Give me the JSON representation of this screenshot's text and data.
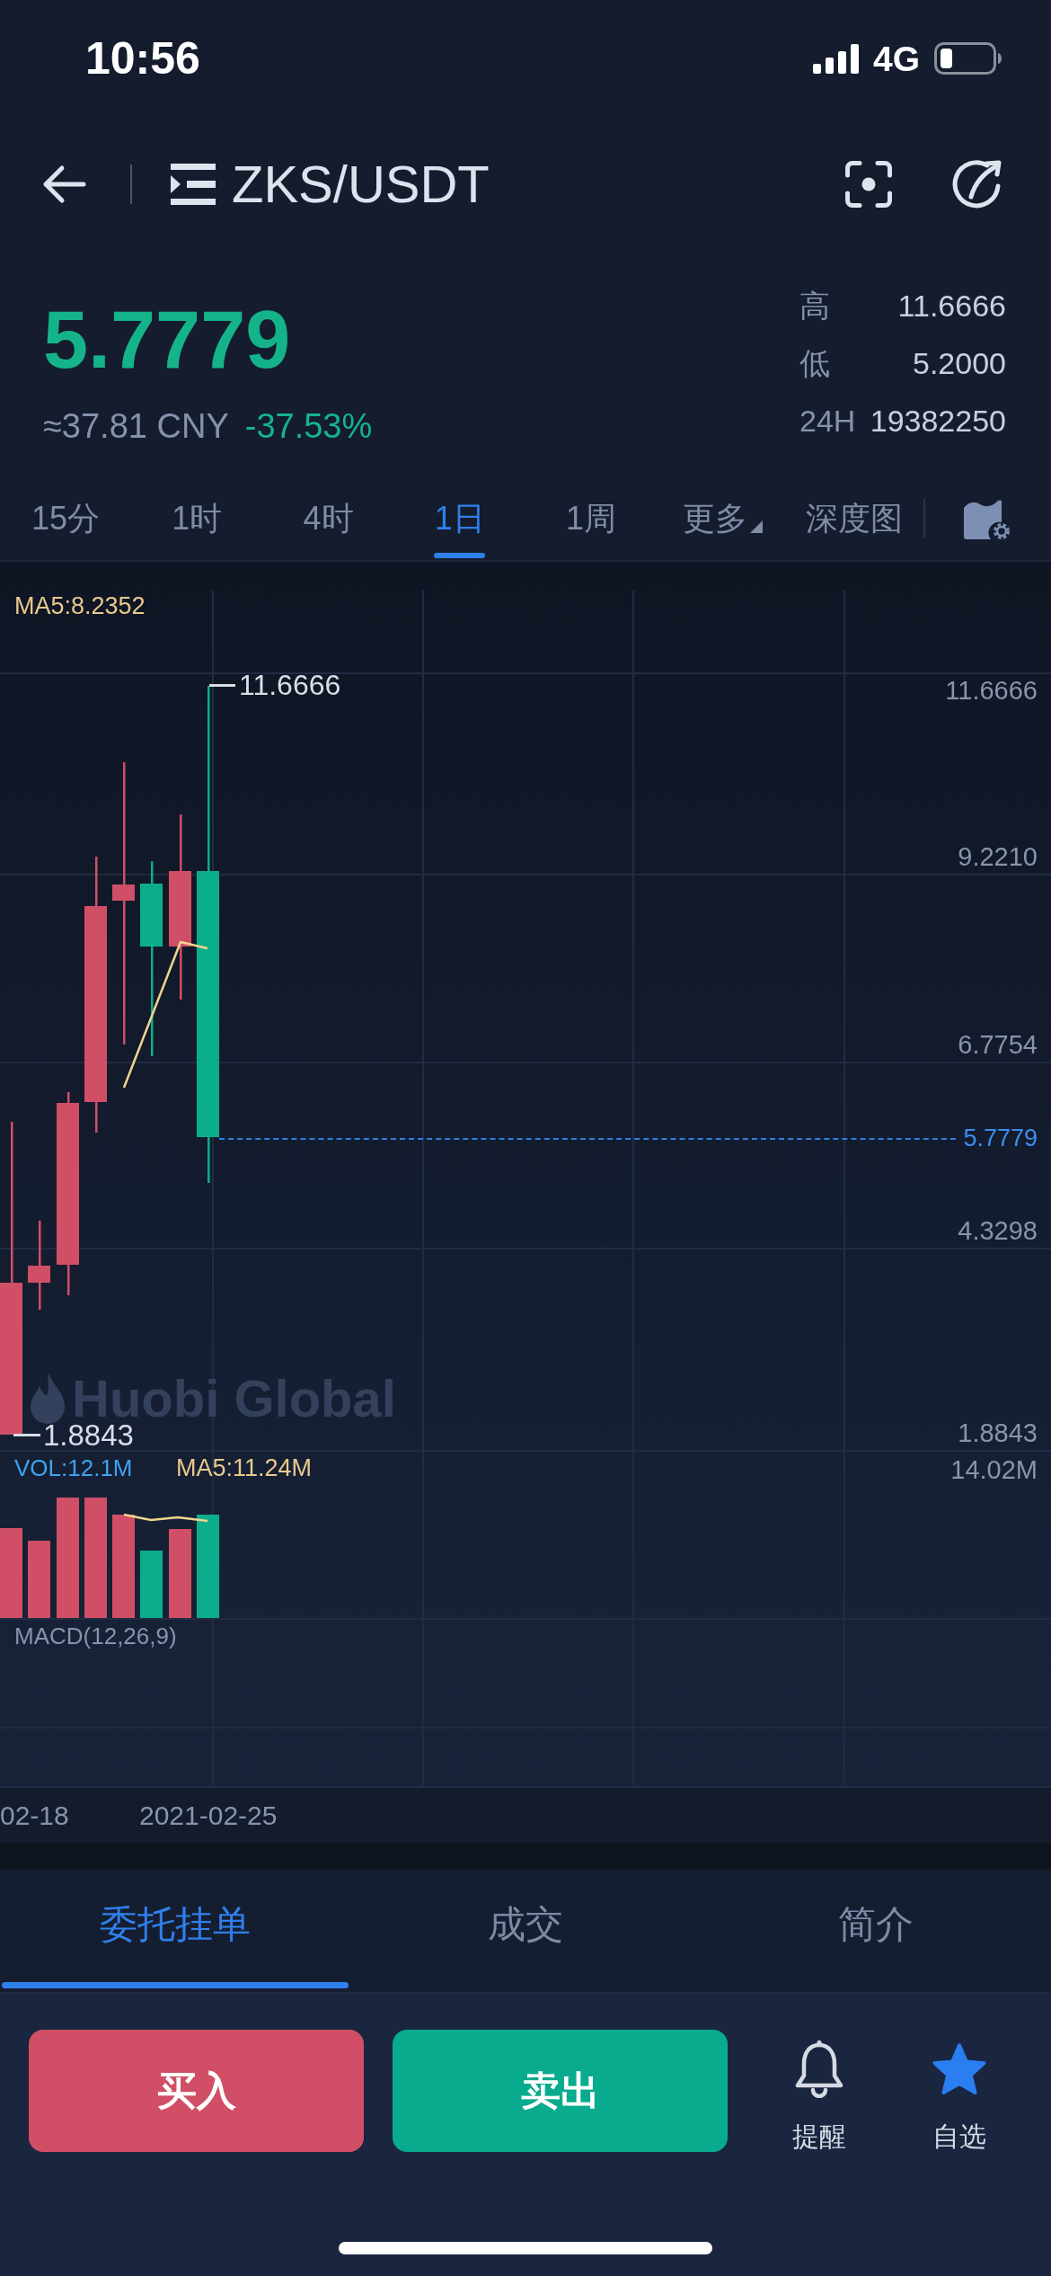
{
  "status_bar": {
    "time": "10:56",
    "network": "4G"
  },
  "header": {
    "title": "ZKS/USDT"
  },
  "ticker": {
    "price": "5.7779",
    "cny": "≈37.81 CNY",
    "change": "-37.53%",
    "stats": [
      {
        "label": "高",
        "value": "11.6666"
      },
      {
        "label": "低",
        "value": "5.2000"
      },
      {
        "label": "24H",
        "value": "19382250"
      }
    ]
  },
  "intervals": [
    {
      "label": "15分",
      "kind": "interval",
      "selected": false
    },
    {
      "label": "1时",
      "kind": "interval",
      "selected": false
    },
    {
      "label": "4时",
      "kind": "interval",
      "selected": false
    },
    {
      "label": "1日",
      "kind": "interval",
      "selected": true
    },
    {
      "label": "1周",
      "kind": "interval",
      "selected": false
    },
    {
      "label": "更多",
      "kind": "menu",
      "selected": false
    },
    {
      "label": "深度图",
      "kind": "interval",
      "selected": false
    }
  ],
  "chart": {
    "ma_label": "MA5:8.2352",
    "y_labels": [
      "11.6666",
      "9.2210",
      "6.7754",
      "4.3298",
      "1.8843"
    ],
    "high_marker": "11.6666",
    "low_marker": "1.8843",
    "last_price": "5.7779",
    "watermark": "Huobi Global",
    "volume_label": "VOL:12.1M",
    "volume_ma_label": "MA5:11.24M",
    "volume_max": "14.02M",
    "macd_label": "MACD(12,26,9)",
    "dates": [
      "02-18",
      "2021-02-25"
    ]
  },
  "order_tabs": [
    {
      "label": "委托挂单",
      "selected": true
    },
    {
      "label": "成交",
      "selected": false
    },
    {
      "label": "简介",
      "selected": false
    }
  ],
  "actions": {
    "buy": "买入",
    "sell": "卖出",
    "alert": "提醒",
    "favorite": {
      "label": "自选",
      "on": true
    }
  }
}
